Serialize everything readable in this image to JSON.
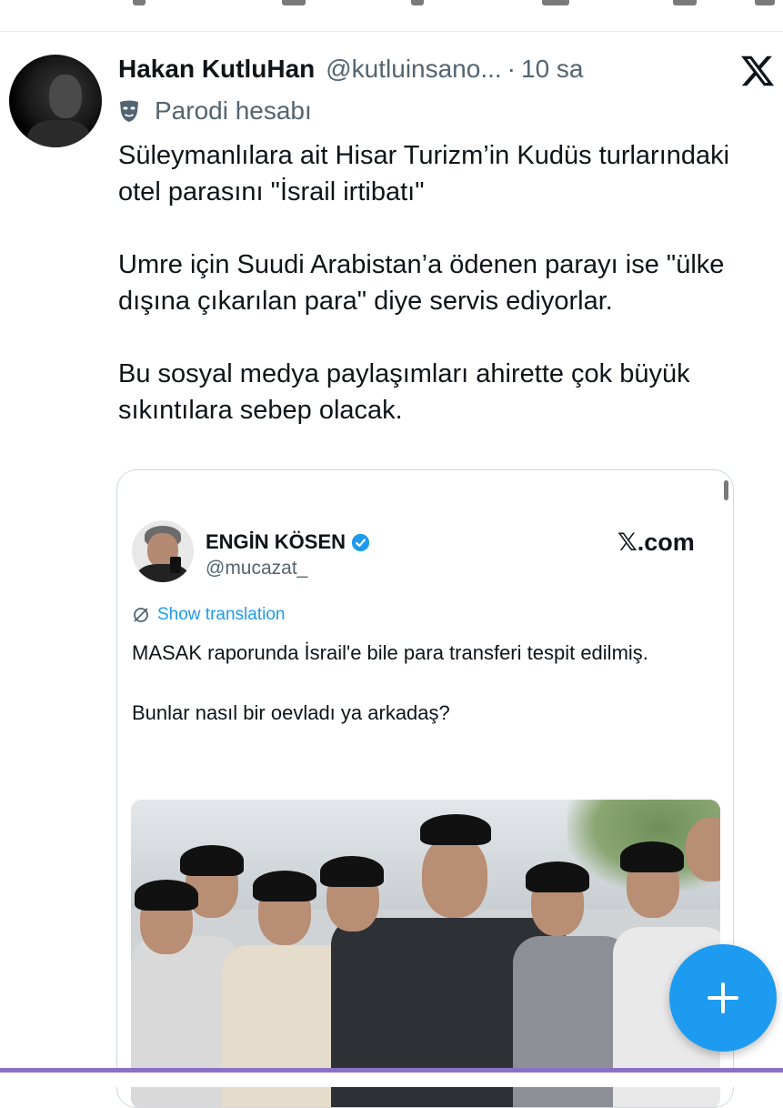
{
  "tweet": {
    "author_name": "Hakan KutluHan",
    "author_handle": "@kutluinsano...",
    "separator": "·",
    "time": "10 sa",
    "account_label": "Parodi hesabı",
    "paragraphs": [
      "Süleymanlılara ait Hisar Turizm’in Kudüs turlarındaki otel parasını \"İsrail irtibatı\"",
      "Umre için Suudi Arabistan’a ödenen parayı ise \"ülke dışına çıkarılan para\" diye servis ediyorlar.",
      "Bu sosyal medya paylaşımları ahirette çok büyük sıkıntılara sebep olacak."
    ]
  },
  "quote": {
    "author_name": "ENGİN KÖSEN",
    "author_handle": "@mucazat_",
    "site_label": "𝕏.com",
    "translate_label": "Show translation",
    "paragraphs": [
      "MASAK raporunda İsrail'e bile para transferi tespit edilmiş.",
      "Bunlar nasıl bir oevladı ya arkadaş?"
    ]
  },
  "icons": {
    "x_logo": "x-logo-icon",
    "parody": "parody-mask-icon",
    "verified": "verified-badge-icon",
    "translate": "globe-icon",
    "compose": "plus-icon"
  },
  "colors": {
    "accent": "#1d9bf0",
    "secondary_text": "#536471",
    "primary_text": "#0f1419",
    "bottom_bar": "#8b70c7"
  }
}
